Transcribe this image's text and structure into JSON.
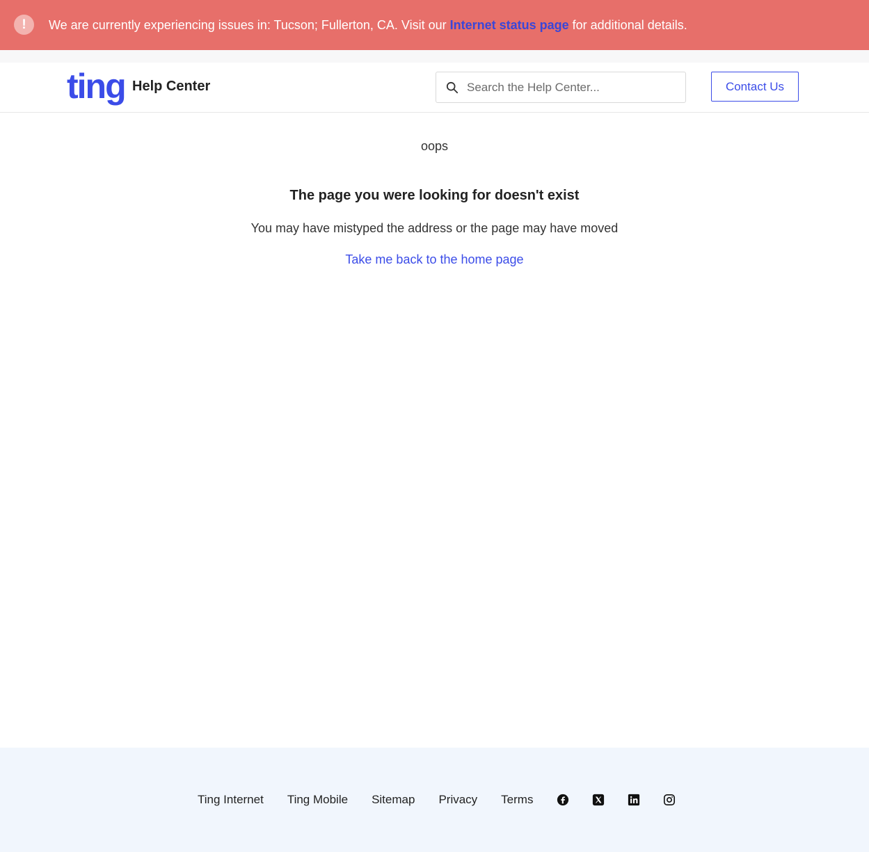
{
  "alert": {
    "icon": "exclamation-icon",
    "text_before": "We are currently experiencing issues in: Tucson; Fullerton, CA. Visit our ",
    "link_text": "Internet status page",
    "text_after": " for additional details.",
    "background": "#e76f6a"
  },
  "header": {
    "logo_text": "ting",
    "title": "Help Center",
    "search_placeholder": "Search the Help Center...",
    "contact_label": "Contact Us",
    "brand_color": "#3b4ce8"
  },
  "main": {
    "oops": "oops",
    "title": "The page you were looking for doesn't exist",
    "subtitle": "You may have mistyped the address or the page may have moved",
    "home_link": "Take me back to the home page"
  },
  "footer": {
    "links": [
      "Ting Internet",
      "Ting Mobile",
      "Sitemap",
      "Privacy",
      "Terms"
    ],
    "social_icons": [
      "facebook-icon",
      "x-icon",
      "linkedin-icon",
      "instagram-icon"
    ]
  }
}
